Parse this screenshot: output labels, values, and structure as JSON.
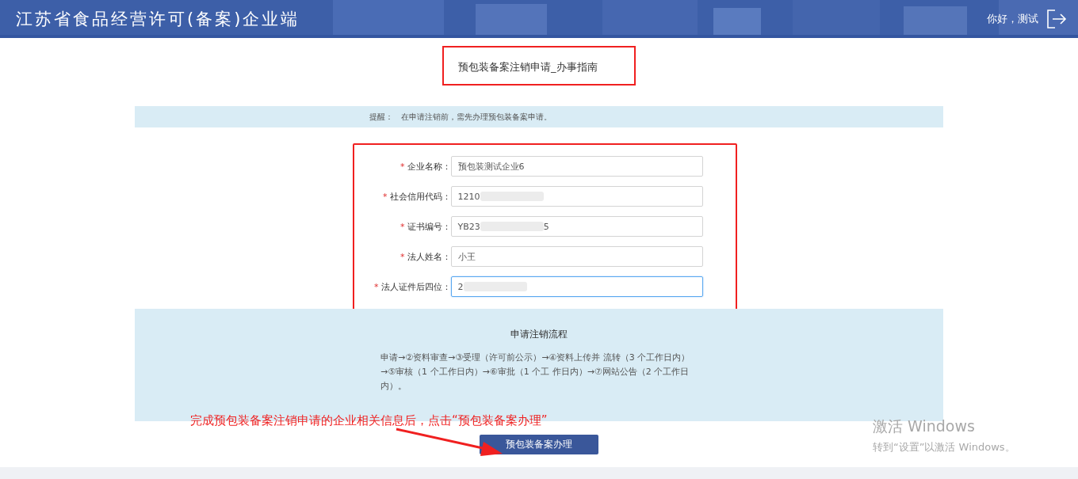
{
  "header": {
    "title": "江苏省食品经营许可(备案)企业端",
    "greeting": "你好，测试"
  },
  "page_title": "预包装备案注销申请_办事指南",
  "notice": {
    "label": "提醒：",
    "text": "在申请注销前，需先办理预包装备案申请。"
  },
  "form": {
    "fields": [
      {
        "label": "企业名称：",
        "required_mark": "*",
        "value": "预包装测试企业6",
        "redacted": false,
        "focused": false
      },
      {
        "label": "社会信用代码：",
        "required_mark": "*",
        "value": "1210",
        "redacted": true,
        "focused": false
      },
      {
        "label": "证书编号：",
        "required_mark": "*",
        "value": "YB23",
        "redacted": true,
        "suffix": "5",
        "focused": false
      },
      {
        "label": "法人姓名：",
        "required_mark": "*",
        "value": "小王",
        "redacted": false,
        "focused": false
      },
      {
        "label": "法人证件后四位：",
        "required_mark": "*",
        "value": "2",
        "redacted": true,
        "focused": true
      }
    ]
  },
  "process": {
    "title": "申请注销流程",
    "text": "申请→②资料审查→③受理（许可前公示）→④资料上传并 流转（3 个工作日内）→⑤审核（1 个工作日内）→⑥审批（1 个工 作日内）→⑦网站公告（2 个工作日内）。"
  },
  "annotation": "完成预包装备案注销申请的企业相关信息后，点击“预包装备案办理”",
  "submit_button": "预包装备案办理",
  "os_watermark": {
    "title": "激活 Windows",
    "text": "转到“设置”以激活 Windows。"
  }
}
